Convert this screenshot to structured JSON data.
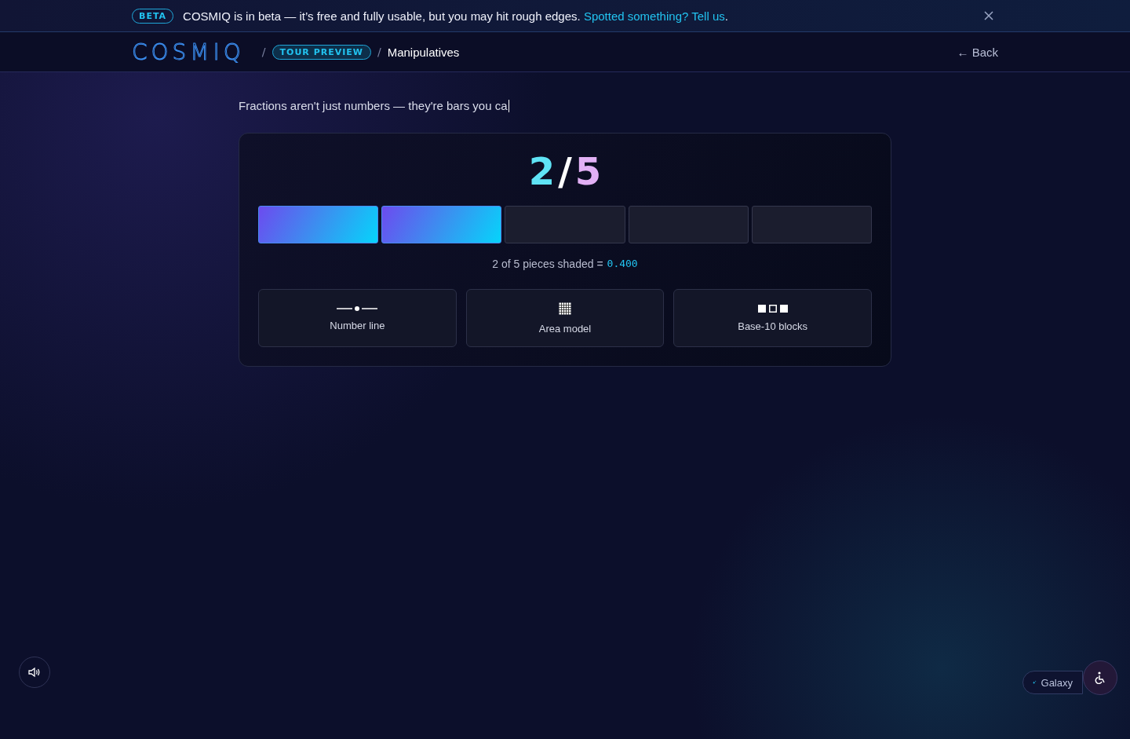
{
  "banner": {
    "badge": "BETA",
    "message": "COSMIQ is in beta — it’s free and fully usable, but you may hit rough edges.",
    "link": "Spotted something? Tell us",
    "end": "."
  },
  "header": {
    "logo": "COSMIQ",
    "separator": "/",
    "tour": "TOUR PREVIEW",
    "page": "Manipulatives",
    "back": "← Back"
  },
  "intro": "Fractions aren't just numbers — they're bars you ca",
  "fraction": {
    "numerator": "2",
    "slash": "/",
    "denominator": "5"
  },
  "pieces": [
    {
      "shaded": true
    },
    {
      "shaded": true
    },
    {
      "shaded": false
    },
    {
      "shaded": false
    },
    {
      "shaded": false
    }
  ],
  "caption": {
    "text": "2 of 5 pieces shaded =",
    "value": "0.400"
  },
  "models": [
    {
      "kind": "number-line",
      "label": "Number line"
    },
    {
      "kind": "area",
      "label": "Area model"
    },
    {
      "kind": "blocks",
      "label": "Base-10 blocks"
    }
  ],
  "galaxy": {
    "label": "Galaxy"
  }
}
